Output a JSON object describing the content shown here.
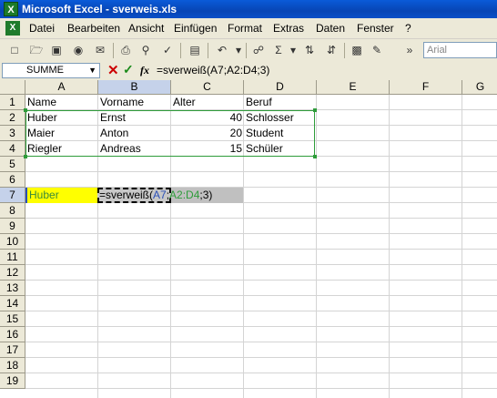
{
  "window": {
    "title": "Microsoft Excel - sverweis.xls",
    "app_icon": "X"
  },
  "menu": [
    "Datei",
    "Bearbeiten",
    "Ansicht",
    "Einfügen",
    "Format",
    "Extras",
    "Daten",
    "Fenster",
    "?"
  ],
  "toolbar": {
    "font_name": "Arial"
  },
  "formula_bar": {
    "name_box": "SUMME",
    "fx": "fx",
    "formula": "=sverweiß(A7;A2:D4;3)"
  },
  "columns": [
    "A",
    "B",
    "C",
    "D",
    "E",
    "F",
    "G"
  ],
  "rows": [
    "1",
    "2",
    "3",
    "4",
    "5",
    "6",
    "7",
    "8",
    "9",
    "10",
    "11",
    "12",
    "13",
    "14",
    "15",
    "16",
    "17",
    "18",
    "19"
  ],
  "table": {
    "headers": [
      "Name",
      "Vorname",
      "Alter",
      "Beruf"
    ],
    "data": [
      [
        "Huber",
        "Ernst",
        "40",
        "Schlosser"
      ],
      [
        "Maier",
        "Anton",
        "20",
        "Student"
      ],
      [
        "Riegler",
        "Andreas",
        "15",
        "Schüler"
      ]
    ]
  },
  "row7": {
    "a7": "Huber",
    "b7_parts": {
      "prefix": "=sverweiß(",
      "ref1": "A7",
      "sep1": ";",
      "ref2": "A2:D4",
      "rest": ";3)"
    }
  }
}
